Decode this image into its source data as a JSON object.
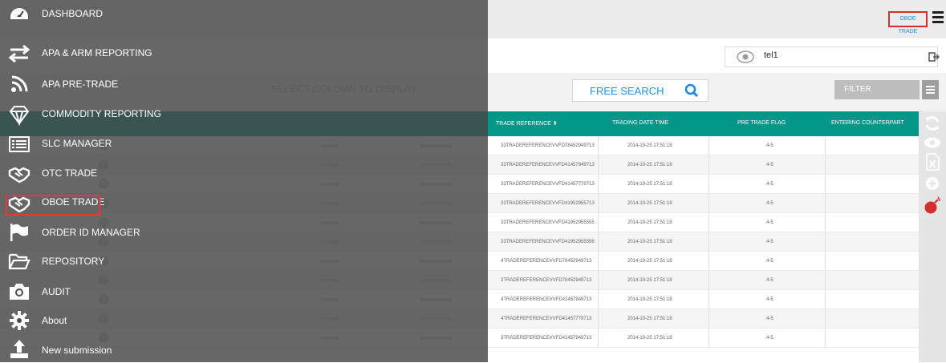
{
  "header": {
    "brand": "OBOE TRADE"
  },
  "user": {
    "name": "tel1"
  },
  "toolbar": {
    "search_label": "FREE SEARCH",
    "filter_placeholder": "FILTER",
    "column_select_label": "SELECT COLUMN TO DISPLAY"
  },
  "table": {
    "columns": [
      "TRADE REFERENCE ⬍",
      "TRADING DATE TIME",
      "PRE TRADE FLAG",
      "ENTERING COUNTERPART"
    ],
    "rows": [
      {
        "ref": "33TRADEREFERENCEVVFD78452949713",
        "time": "2014-10-25 17:51:18",
        "flag": "4-5",
        "cp": ""
      },
      {
        "ref": "33TRADEREFERENCEVVFD41457949713",
        "time": "2014-10-25 17:51:18",
        "flag": "4-5",
        "cp": ""
      },
      {
        "ref": "33TRADEREFERENCEVVFD41457779713",
        "time": "2014-10-25 17:51:18",
        "flag": "4-5",
        "cp": ""
      },
      {
        "ref": "33TRADEREFERENCEVVFD41952955713",
        "time": "2014-10-25 17:51:18",
        "flag": "4-5",
        "cp": ""
      },
      {
        "ref": "33TRADEREFERENCEVVFD41952955555",
        "time": "2014-10-25 17:51:18",
        "flag": "4-5",
        "cp": ""
      },
      {
        "ref": "33TRADEREFERENCEVVFD41952955556",
        "time": "2014-10-25 17:51:18",
        "flag": "4-5",
        "cp": ""
      },
      {
        "ref": "4TRADEREFERENCEVVFD78452949713",
        "time": "2014-10-25 17:51:18",
        "flag": "4-5",
        "cp": ""
      },
      {
        "ref": "3TRADEREFERENCEVVFD78452949713",
        "time": "2014-10-25 17:51:18",
        "flag": "4-5",
        "cp": ""
      },
      {
        "ref": "4TRADEREFERENCEVVFD41457949713",
        "time": "2014-10-25 17:51:18",
        "flag": "4-5",
        "cp": ""
      },
      {
        "ref": "4TRADEREFERENCEVVFD41457779713",
        "time": "2014-10-25 17:51:18",
        "flag": "4-5",
        "cp": ""
      },
      {
        "ref": "3TRADEREFERENCEVVFD41457949713",
        "time": "2014-10-25 17:51:18",
        "flag": "4-5",
        "cp": ""
      }
    ]
  },
  "menu": {
    "items": [
      {
        "label": "DASHBOARD",
        "icon": "dashboard-icon"
      },
      {
        "label": "APA & ARM REPORTING",
        "icon": "arrows-icon"
      },
      {
        "label": "APA PRE-TRADE",
        "icon": "rss-icon"
      },
      {
        "label": "COMMODITY REPORTING",
        "icon": "diamond-icon"
      },
      {
        "label": "SLC MANAGER",
        "icon": "list-icon"
      },
      {
        "label": "OTC TRADE",
        "icon": "handshake-icon"
      },
      {
        "label": "OBOE TRADE",
        "icon": "handshake-icon"
      },
      {
        "label": "ORDER ID MANAGER",
        "icon": "flag-icon"
      },
      {
        "label": "REPOSITORY",
        "icon": "folder-icon"
      },
      {
        "label": "AUDIT",
        "icon": "camera-icon"
      },
      {
        "label": "About",
        "icon": "gear-icon"
      },
      {
        "label": "New submission",
        "icon": "upload-icon"
      }
    ]
  },
  "colors": {
    "accent": "#009688",
    "link": "#1e88e5",
    "highlight": "#e53935"
  }
}
